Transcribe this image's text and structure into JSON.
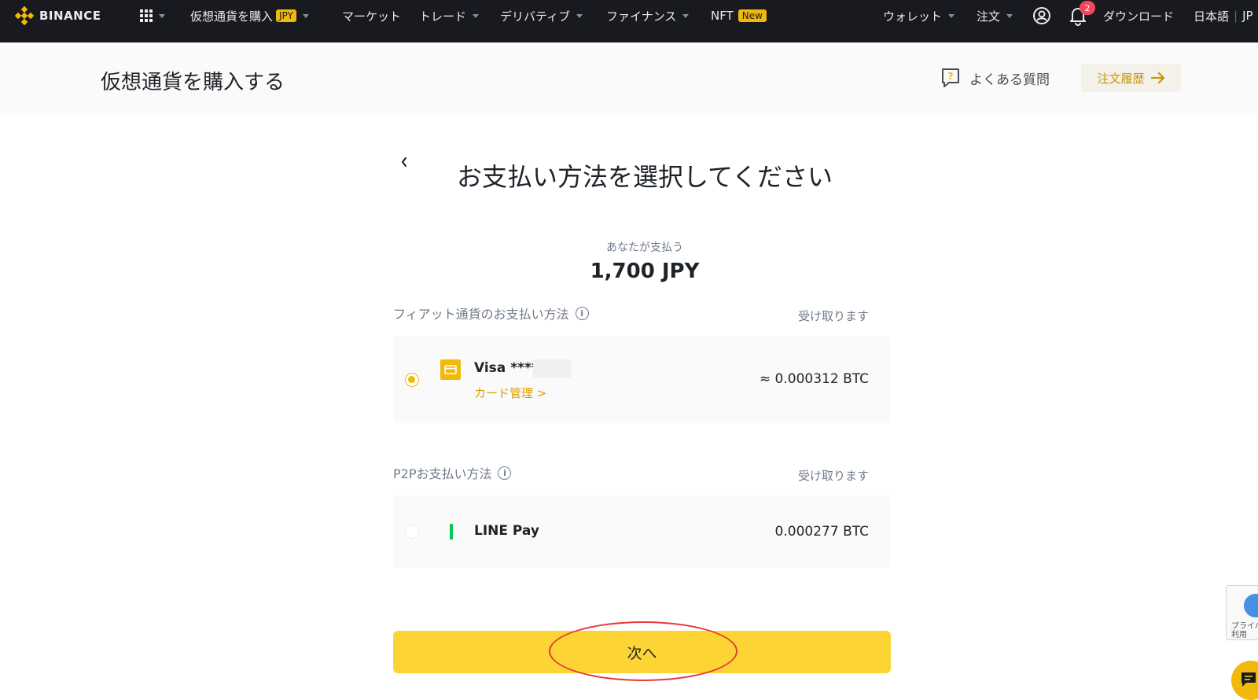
{
  "nav": {
    "brand": "BINANCE",
    "buy_crypto": "仮想通貨を購入",
    "buy_crypto_badge": "JPY",
    "markets": "マーケット",
    "trade": "トレード",
    "derivatives": "デリバティブ",
    "finance": "ファイナンス",
    "nft": "NFT",
    "nft_badge": "New",
    "wallet": "ウォレット",
    "orders": "注文",
    "notification_count": "2",
    "download": "ダウンロード",
    "language": "日本語",
    "currency": "JP"
  },
  "header": {
    "title": "仮想通貨を購入する",
    "faq": "よくある質問",
    "order_history": "注文履歴"
  },
  "main": {
    "title": "お支払い方法を選択してください",
    "you_pay_label": "あなたが支払う",
    "you_pay_amount": "1,700 JPY",
    "fiat_section_label": "フィアット通貨のお支払い方法",
    "fiat_receive_label": "受け取ります",
    "fiat_method": {
      "name": "Visa ****",
      "manage_link": "カード管理 >",
      "amount": "≈ 0.000312 BTC",
      "selected": true
    },
    "p2p_section_label": "P2Pお支払い方法",
    "p2p_receive_label": "受け取ります",
    "p2p_method": {
      "name": "LINE Pay",
      "amount": "0.000277 BTC",
      "selected": false
    },
    "next_button": "次へ"
  },
  "recaptcha": {
    "text_line1": "プライバ",
    "text_line2": "利用"
  },
  "colors": {
    "brand_yellow": "#f0b90b",
    "button_yellow": "#fcd535",
    "nav_bg": "#181a20",
    "annotation_red": "#e53935",
    "line_green": "#06c755"
  }
}
